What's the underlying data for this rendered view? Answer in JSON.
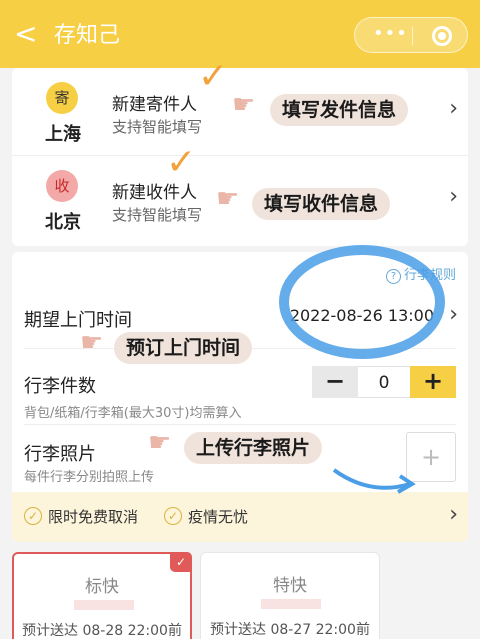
{
  "header": {
    "back_icon": "chevron-left-icon",
    "title": "存知己",
    "more_icon": "more-dots-icon",
    "close_icon": "target-ring-icon",
    "accent_color": "#f7cf45"
  },
  "sender": {
    "badge": "寄",
    "city": "上海",
    "title": "新建寄件人",
    "subtitle": "支持智能填写",
    "annotation": "填写发件信息"
  },
  "receiver": {
    "badge": "收",
    "city": "北京",
    "title": "新建收件人",
    "subtitle": "支持智能填写",
    "annotation": "填写收件信息"
  },
  "form": {
    "rules_link": "行李规则",
    "pickup_label": "期望上门时间",
    "pickup_value": "2022-08-26 13:00",
    "pickup_annotation": "预订上门时间",
    "count_label": "行李件数",
    "count_sub": "背包/纸箱/行李箱(最大30寸)均需算入",
    "count_value": "0",
    "minus": "−",
    "plus": "+",
    "photo_label": "行李照片",
    "photo_sub": "每件行李分别拍照上传",
    "photo_add": "+",
    "photo_annotation": "上传行李照片"
  },
  "benefits": {
    "item1": "限时免费取消",
    "item2": "疫情无忧"
  },
  "options": [
    {
      "name": "标快",
      "eta": "预计送达 08-28 22:00前",
      "selected": true
    },
    {
      "name": "特快",
      "eta": "预计送达 08-27 22:00前",
      "selected": false
    }
  ]
}
